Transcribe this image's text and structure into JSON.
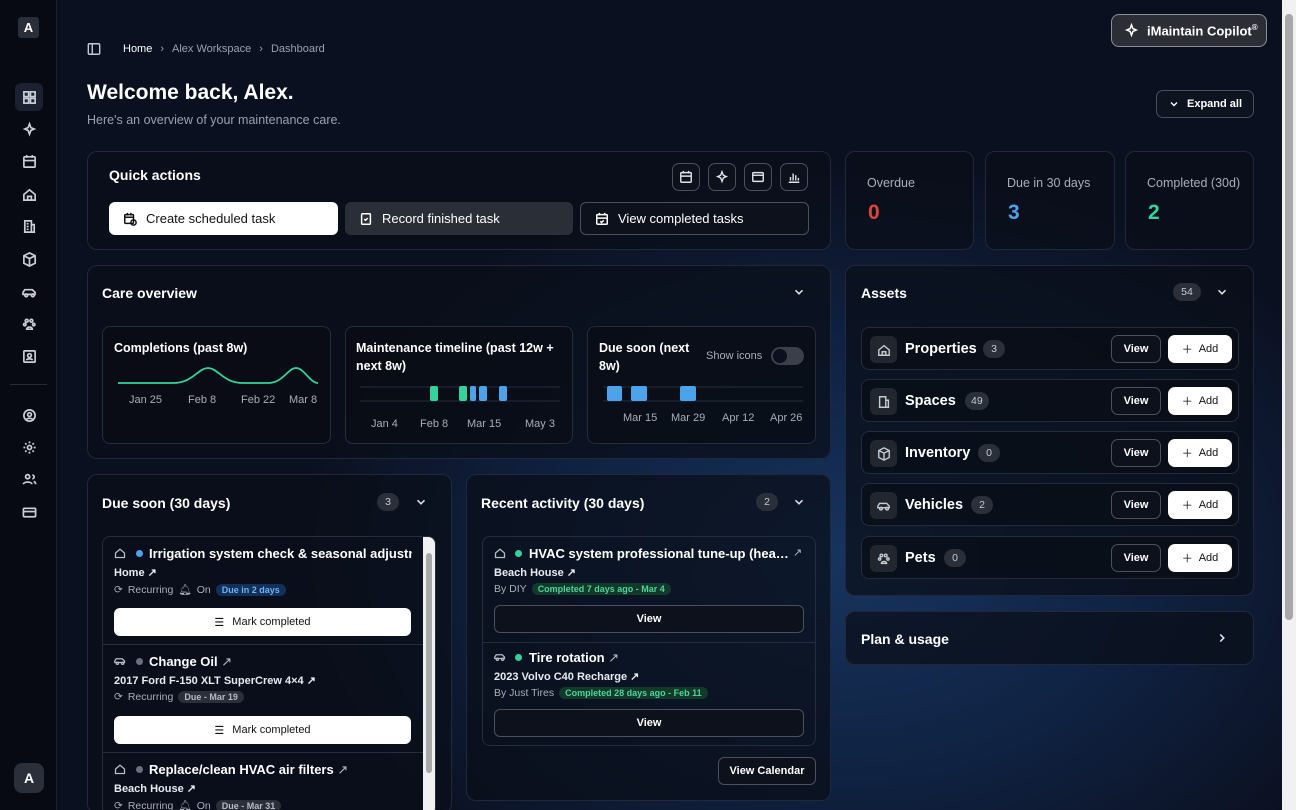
{
  "sidebar": {
    "logo": "A",
    "avatar": "A",
    "icons": [
      "dashboard-icon",
      "sparkles-icon",
      "calendar-icon",
      "home-icon",
      "building-icon",
      "package-icon",
      "car-icon",
      "paw-icon",
      "contacts-icon",
      "user-circle-icon",
      "gear-icon",
      "users-icon",
      "credit-card-icon"
    ]
  },
  "copilot": {
    "label": "iMaintain Copilot",
    "mark": "®"
  },
  "breadcrumb": {
    "home": "Home",
    "workspace": "Alex Workspace",
    "page": "Dashboard"
  },
  "header": {
    "title": "Welcome back, Alex.",
    "subtitle": "Here's an overview of your maintenance care.",
    "expand_all": "Expand all"
  },
  "quick_actions": {
    "title": "Quick actions",
    "create": "Create scheduled task",
    "record": "Record finished task",
    "view_completed": "View completed tasks"
  },
  "stats": {
    "overdue": {
      "label": "Overdue",
      "value": "0",
      "color": "#e0443a"
    },
    "due30": {
      "label": "Due in 30 days",
      "value": "3",
      "color": "#4da3ea"
    },
    "completed": {
      "label": "Completed (30d)",
      "value": "2",
      "color": "#33d39a"
    }
  },
  "care": {
    "title": "Care overview",
    "completions": {
      "title": "Completions (past 8w)",
      "ticks": [
        "Jan 25",
        "Feb 8",
        "Feb 22",
        "Mar 8"
      ]
    },
    "timeline": {
      "title": "Maintenance timeline (past 12w + next 8w)",
      "ticks": [
        "Jan 4",
        "Feb 8",
        "Mar 15",
        "May 3"
      ]
    },
    "due_soon": {
      "title": "Due soon (next 8w)",
      "toggle": "Show icons",
      "ticks": [
        "Mar 15",
        "Mar 29",
        "Apr 12",
        "Apr 26"
      ]
    }
  },
  "assets": {
    "title": "Assets",
    "count": "54",
    "view": "View",
    "add": "Add",
    "rows": [
      {
        "name": "Properties",
        "count": "3",
        "icon": "home-icon"
      },
      {
        "name": "Spaces",
        "count": "49",
        "icon": "building-icon"
      },
      {
        "name": "Inventory",
        "count": "0",
        "icon": "package-icon"
      },
      {
        "name": "Vehicles",
        "count": "2",
        "icon": "car-icon"
      },
      {
        "name": "Pets",
        "count": "0",
        "icon": "paw-icon"
      }
    ]
  },
  "plan": {
    "title": "Plan & usage"
  },
  "due_soon": {
    "title": "Due soon (30 days)",
    "count": "3",
    "mark_completed": "Mark completed",
    "tasks": [
      {
        "title": "Irrigation system check & seasonal adjustment",
        "location": "Home",
        "recurring": "Recurring",
        "on": "On",
        "badge": "Due in 2 days"
      },
      {
        "title": "Change Oil",
        "location": "2017 Ford F-150 XLT SuperCrew 4×4",
        "recurring": "Recurring",
        "badge": "Due - Mar 19"
      },
      {
        "title": "Replace/clean HVAC air filters",
        "location": "Beach House",
        "recurring": "Recurring",
        "on": "On",
        "badge": "Due - Mar 31"
      }
    ]
  },
  "recent": {
    "title": "Recent activity (30 days)",
    "count": "2",
    "view": "View",
    "calendar": "View Calendar",
    "items": [
      {
        "title": "HVAC system professional tune-up (hea…",
        "location": "Beach House",
        "by": "By DIY",
        "badge": "Completed 7 days ago - Mar 4"
      },
      {
        "title": "Tire rotation",
        "location": "2023 Volvo C40 Recharge",
        "by": "By Just Tires",
        "badge": "Completed 28 days ago - Feb 11"
      }
    ]
  }
}
